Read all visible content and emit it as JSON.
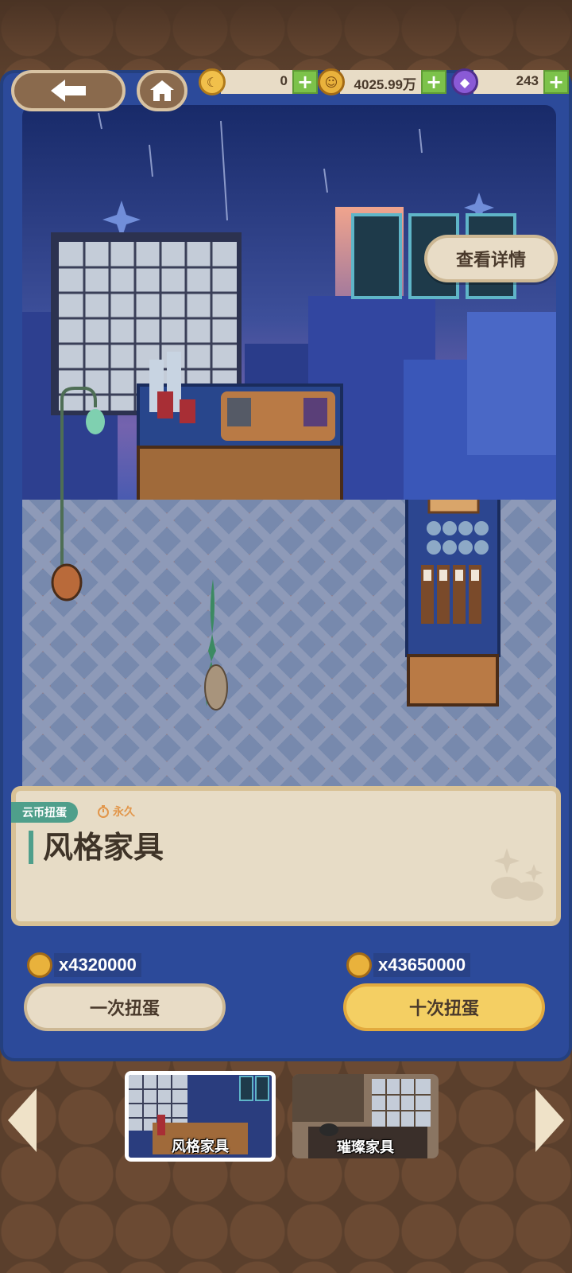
{
  "nav": {
    "back_icon": "arrow-left-icon",
    "home_icon": "house-icon"
  },
  "resources": [
    {
      "name": "moon-coin",
      "value": "0"
    },
    {
      "name": "gold-coin",
      "value": "4025.99万"
    },
    {
      "name": "purple-gem",
      "value": "243"
    }
  ],
  "details_button": "查看详情",
  "card": {
    "tag": "云币扭蛋",
    "duration": "永久",
    "title": "风格家具"
  },
  "draws": {
    "single": {
      "cost": "x4320000",
      "label": "一次扭蛋"
    },
    "ten": {
      "cost": "x43650000",
      "label": "十次扭蛋"
    }
  },
  "tabs": [
    {
      "label": "风格家具",
      "active": true
    },
    {
      "label": "璀璨家具",
      "active": false
    }
  ],
  "colors": {
    "accent_green": "#7cc24a",
    "teal_tag": "#4f9f8b",
    "gold_button": "#f4cf63",
    "cream_button": "#e8dcc6"
  }
}
